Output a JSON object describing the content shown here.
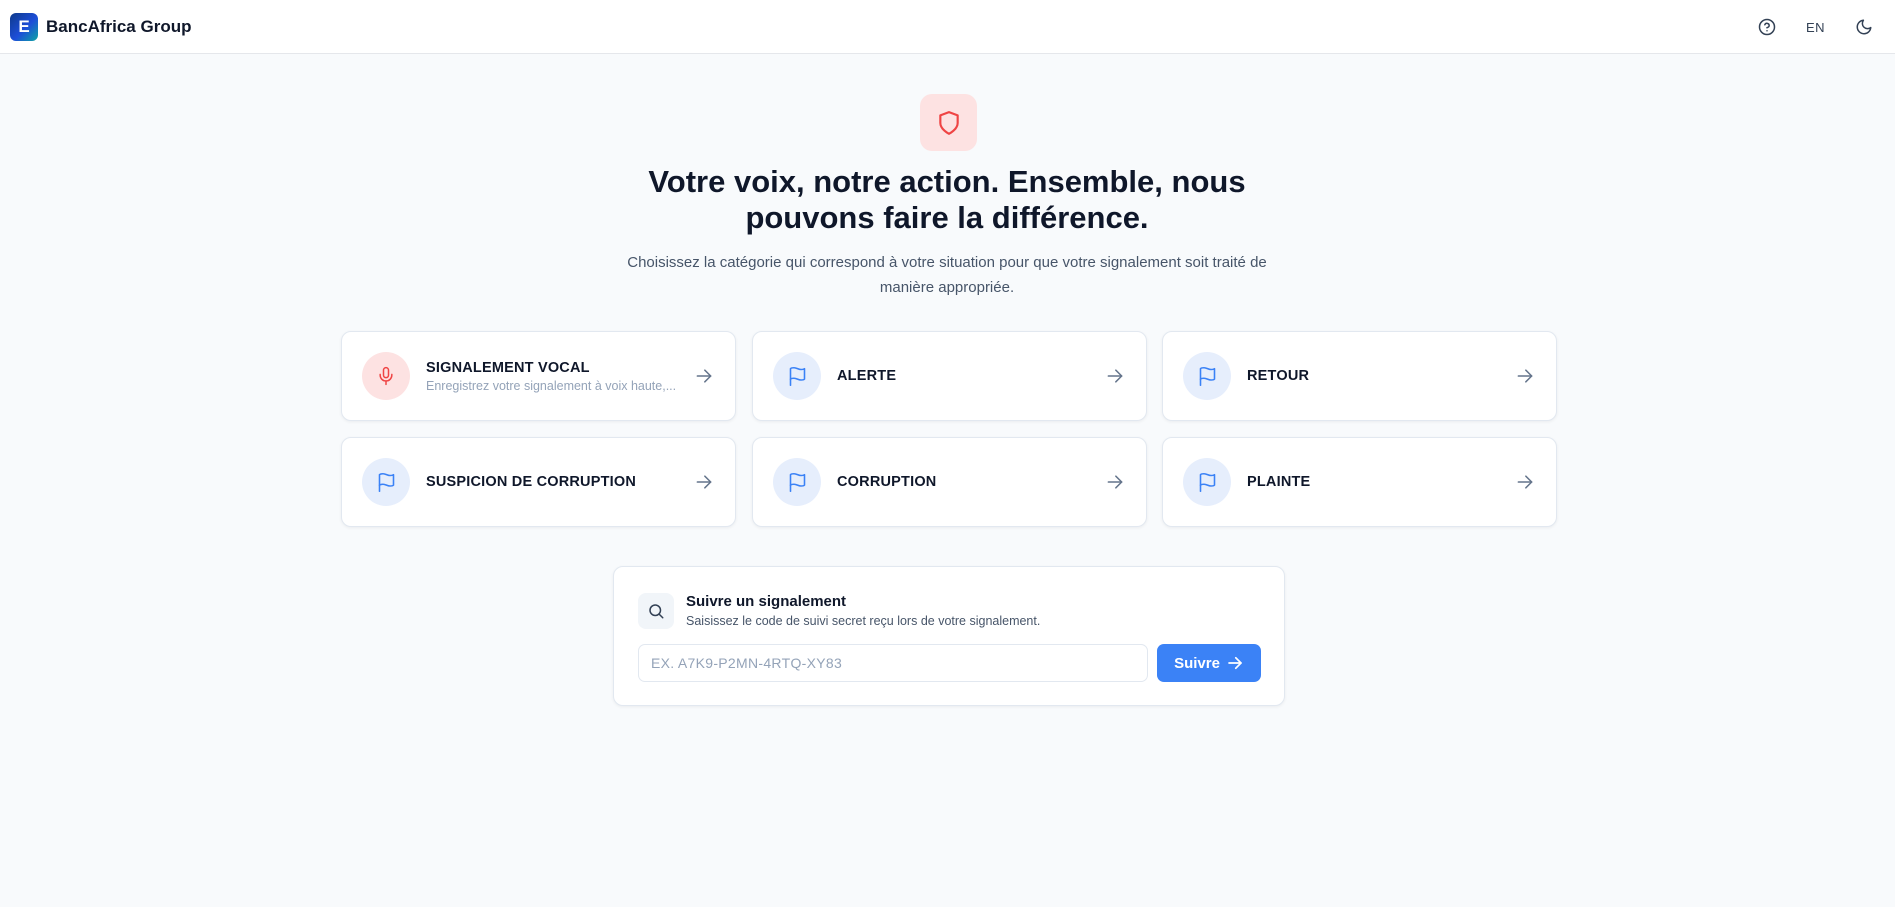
{
  "header": {
    "brand": "BancAfrica Group",
    "logo_letter": "E",
    "language": "EN"
  },
  "hero": {
    "title": "Votre voix, notre action. Ensemble, nous pouvons faire la différence.",
    "subtitle": "Choisissez la catégorie qui correspond à votre situation pour que votre signalement soit traité de manière appropriée."
  },
  "categories": [
    {
      "label": "SIGNALEMENT VOCAL",
      "description": "Enregistrez votre signalement à voix haute,...",
      "icon": "microphone-icon",
      "color": "#ef4444"
    },
    {
      "label": "ALERTE",
      "description": "",
      "icon": "flag-icon",
      "color": "#3b82f6"
    },
    {
      "label": "RETOUR",
      "description": "",
      "icon": "flag-icon",
      "color": "#3b82f6"
    },
    {
      "label": "SUSPICION DE CORRUPTION",
      "description": "",
      "icon": "flag-icon",
      "color": "#3b82f6"
    },
    {
      "label": "CORRUPTION",
      "description": "",
      "icon": "flag-icon",
      "color": "#3b82f6"
    },
    {
      "label": "PLAINTE",
      "description": "",
      "icon": "flag-icon",
      "color": "#3b82f6"
    }
  ],
  "tracking": {
    "title": "Suivre un signalement",
    "description": "Saisissez le code de suivi secret reçu lors de votre signalement.",
    "placeholder": "EX. A7K9-P2MN-4RTQ-XY83",
    "button_label": "Suivre"
  },
  "colors": {
    "accent": "#3b82f6",
    "danger": "#ef4444",
    "background": "#f8fafc"
  }
}
